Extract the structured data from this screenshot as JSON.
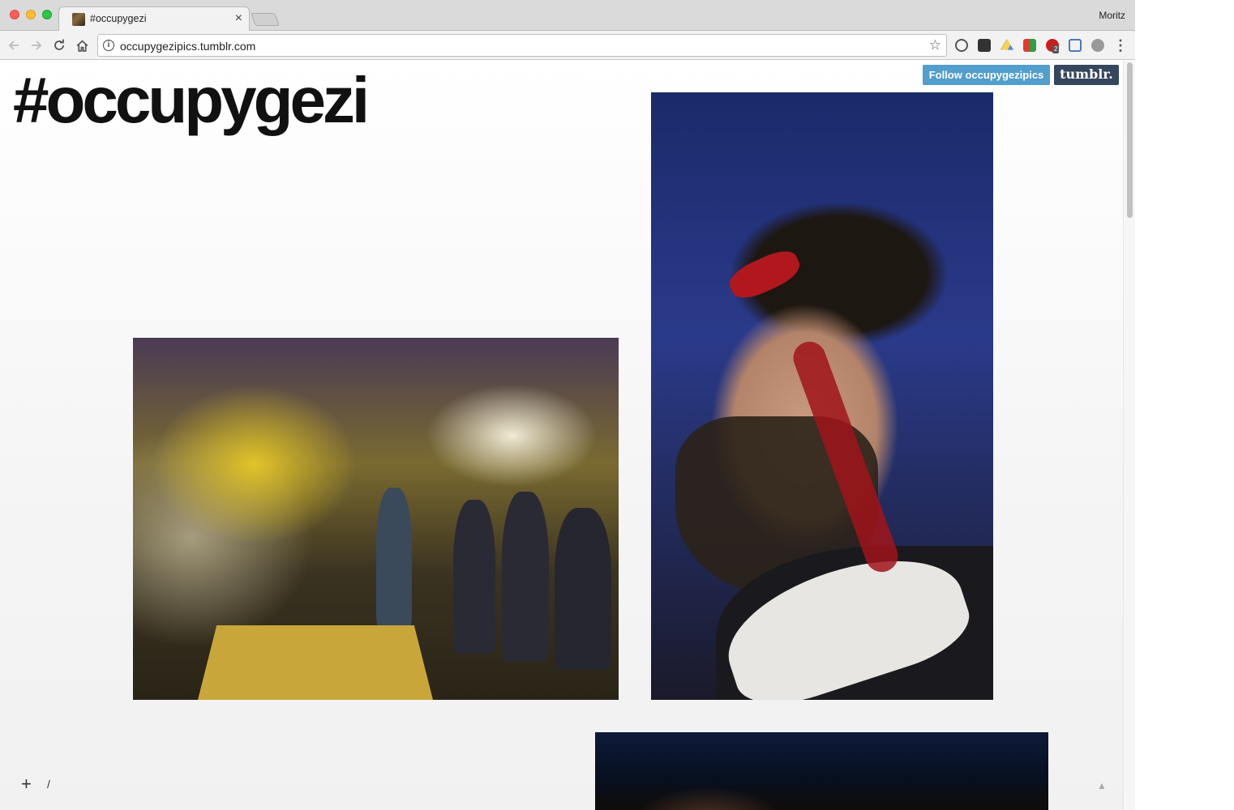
{
  "browser": {
    "tab_title": "#occupygezi",
    "tab_close": "×",
    "profile_name": "Moritz",
    "url": "occupygezipics.tumblr.com",
    "nav": {
      "back": "←",
      "forward": "→",
      "reload": "↻",
      "home": "⌂"
    },
    "star": "☆",
    "info": "i",
    "menu": "⋮",
    "extension_badge": "2"
  },
  "page": {
    "blog_title": "#occupygezi",
    "follow_label": "Follow occupygezipics",
    "tumblr_label": "tumblr.",
    "footer_plus": "+",
    "footer_slash": "/",
    "top_arrow": "▲"
  },
  "colors": {
    "follow_button": "#529ecc",
    "tumblr_button": "#36465d",
    "title_text": "#111111"
  },
  "icons": {
    "back": "arrow-left-icon",
    "forward": "arrow-right-icon",
    "reload": "reload-icon",
    "home": "home-icon",
    "info": "info-icon",
    "star": "star-icon",
    "menu": "kebab-menu-icon"
  }
}
